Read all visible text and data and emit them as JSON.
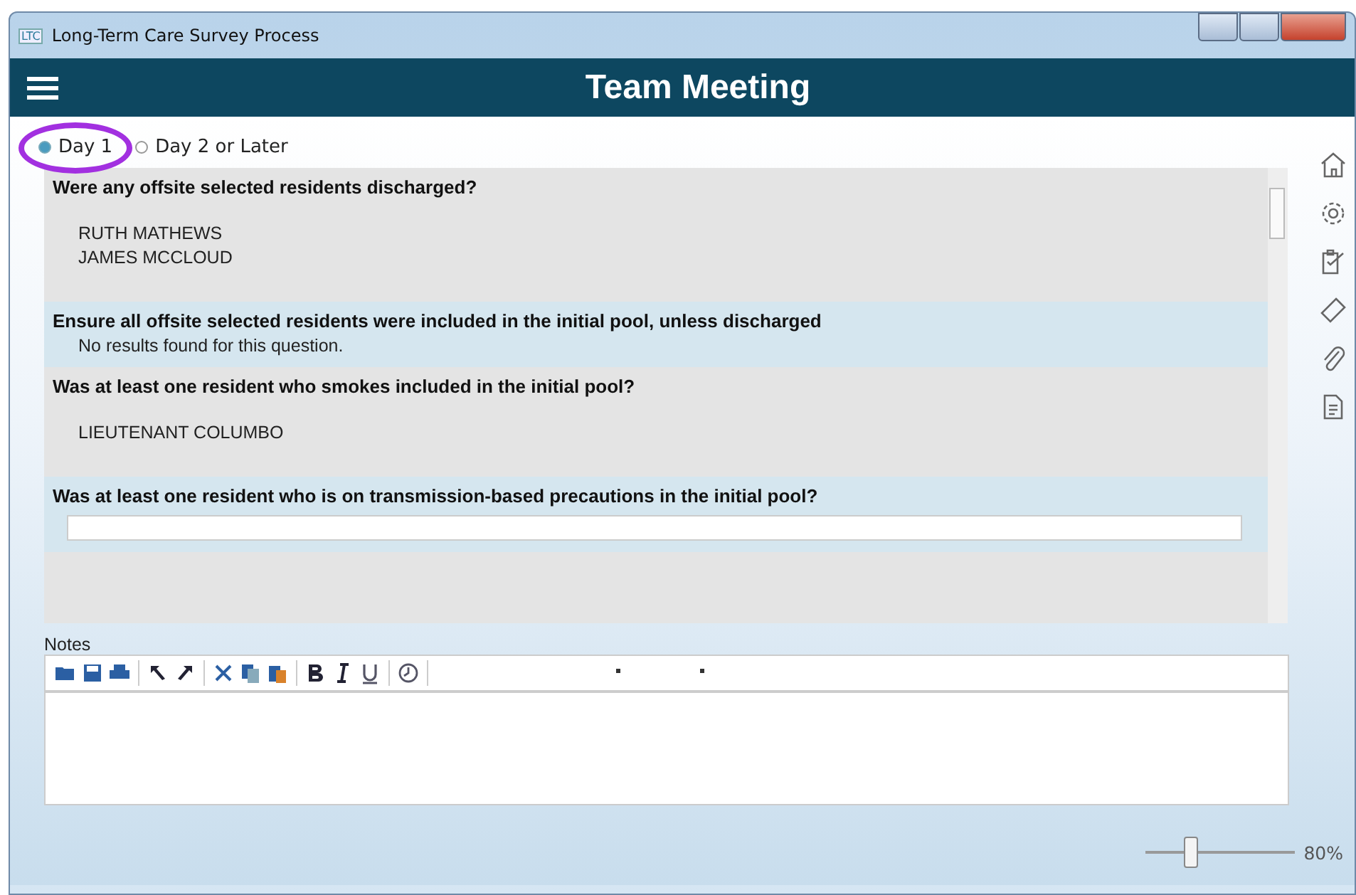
{
  "window": {
    "title": "Long-Term Care Survey Process",
    "app_badge": "LTC"
  },
  "header": {
    "title": "Team Meeting"
  },
  "day_options": [
    {
      "label": "Day 1",
      "selected": true
    },
    {
      "label": "Day 2 or Later",
      "selected": false
    }
  ],
  "questions": [
    {
      "text": "Were any offsite selected residents discharged?",
      "answers": [
        "RUTH MATHEWS",
        "JAMES MCCLOUD"
      ]
    },
    {
      "text": "Ensure all offsite selected residents were included in the initial pool, unless discharged",
      "message": "No results found for this question."
    },
    {
      "text": "Was at least one resident who smokes included in the initial pool?",
      "answers": [
        "LIEUTENANT COLUMBO"
      ]
    },
    {
      "text": "Was at least one resident who is on transmission-based precautions in the initial pool?",
      "kind": "entry"
    }
  ],
  "notes": {
    "label": "Notes"
  },
  "zoom": {
    "level": 0.3,
    "reading": "80%"
  }
}
